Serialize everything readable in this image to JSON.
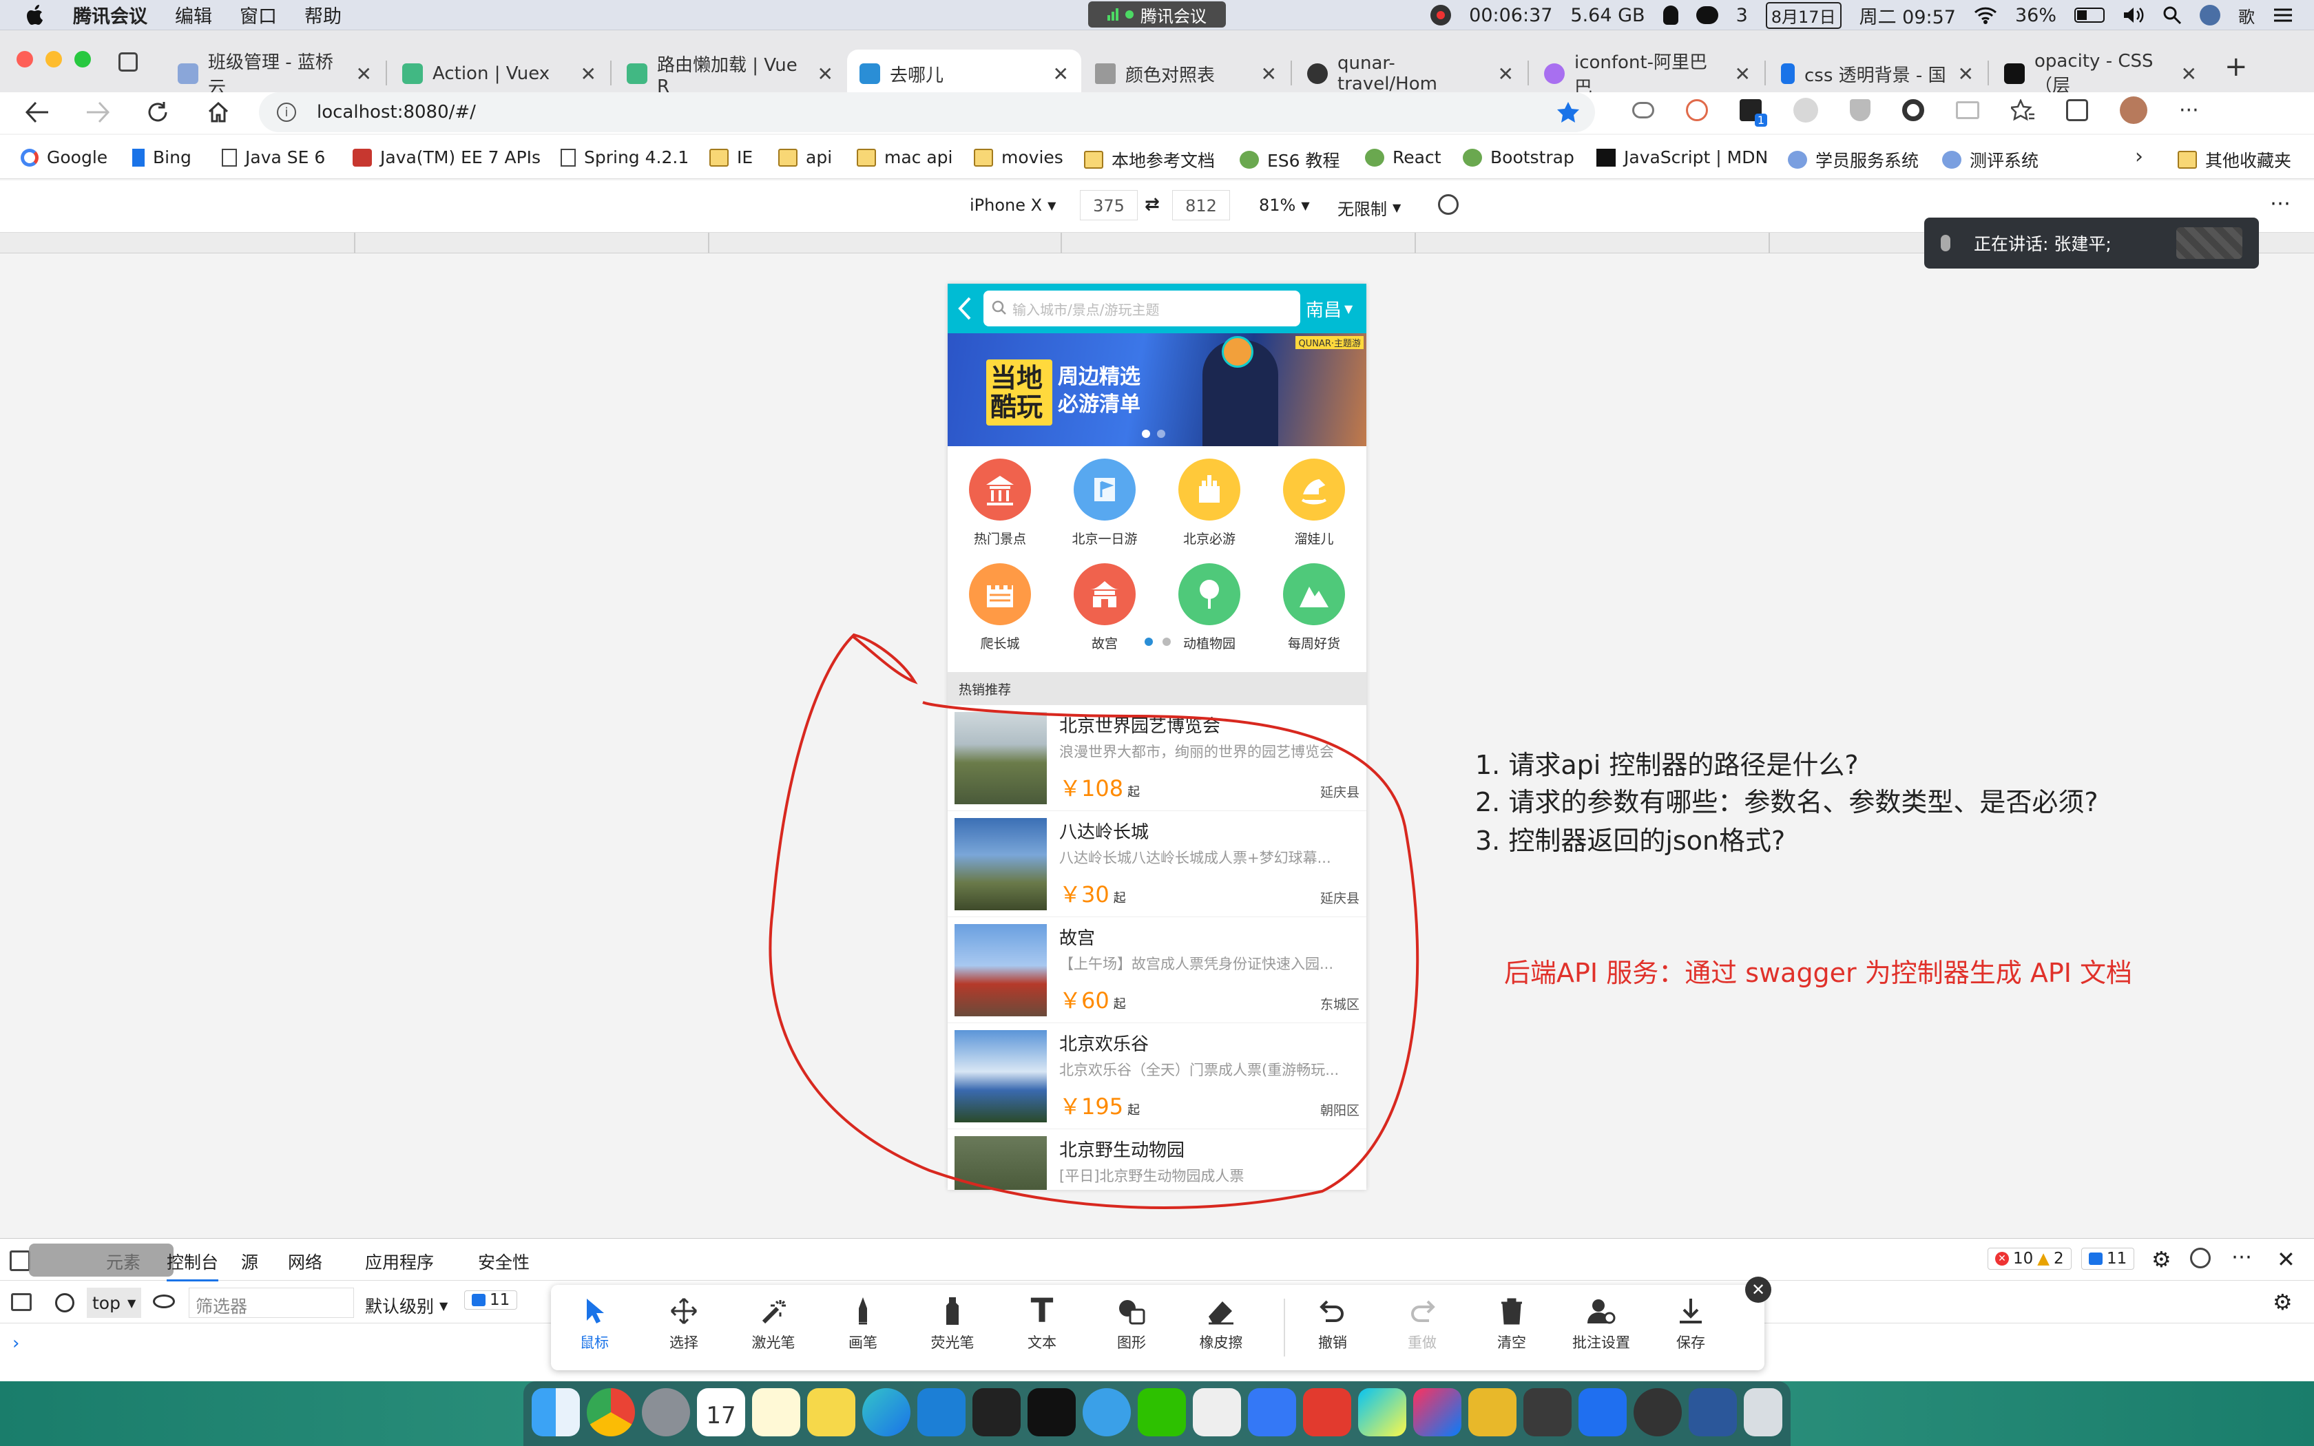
{
  "menubar": {
    "app_name": "腾讯会议",
    "menus": [
      "编辑",
      "窗口",
      "帮助"
    ],
    "meeting_pill": "腾讯会议",
    "record_time": "00:06:37",
    "memory": "5.64 GB",
    "wechat_count": "3",
    "date": "8月17日",
    "weekday_time": "周二 09:57",
    "battery": "36%"
  },
  "tabs": [
    {
      "title": "班级管理 - 蓝桥云",
      "color": "#8aa6d9"
    },
    {
      "title": "Action | Vuex",
      "color": "#41b883"
    },
    {
      "title": "路由懒加载 | Vue R",
      "color": "#41b883"
    },
    {
      "title": "去哪儿",
      "color": "#2a8ed6",
      "active": true
    },
    {
      "title": "颜色对照表",
      "color": "#999999"
    },
    {
      "title": "qunar-travel/Hom",
      "color": "#333333"
    },
    {
      "title": "iconfont-阿里巴巴",
      "color": "#a86ff0"
    },
    {
      "title": "css 透明背景 - 国",
      "color": "#1a73e8"
    },
    {
      "title": "opacity - CSS（层",
      "color": "#111111"
    }
  ],
  "address": {
    "url": "localhost:8080/#/"
  },
  "bookmarks": [
    "Google",
    "Bing",
    "Java SE 6",
    "Java(TM) EE 7 APIs",
    "Spring 4.2.1",
    "IE",
    "api",
    "mac api",
    "movies",
    "本地参考文档",
    "ES6 教程",
    "React",
    "Bootstrap",
    "JavaScript | MDN",
    "学员服务系统",
    "测评系统",
    "其他收藏夹"
  ],
  "devicebar": {
    "device": "iPhone X",
    "width": "375",
    "height": "812",
    "zoom": "81%",
    "throttle": "无限制"
  },
  "phone": {
    "search_placeholder": "输入城市/景点/游玩主题",
    "city": "南昌",
    "banner_title_1": "当地",
    "banner_title_2": "酷玩",
    "banner_sub_1": "周边精选",
    "banner_sub_2": "必游清单",
    "banner_tag": "QUNAR·主题游",
    "icons": [
      {
        "label": "热门景点",
        "color": "#f0624d"
      },
      {
        "label": "北京一日游",
        "color": "#58a8f0"
      },
      {
        "label": "北京必游",
        "color": "#ffc93a"
      },
      {
        "label": "溜娃儿",
        "color": "#ffc93a"
      },
      {
        "label": "爬长城",
        "color": "#ff9a45"
      },
      {
        "label": "故宫",
        "color": "#f0624d"
      },
      {
        "label": "动植物园",
        "color": "#4fc97a"
      },
      {
        "label": "每周好货",
        "color": "#4fc97a"
      }
    ],
    "hot_title": "热销推荐",
    "items": [
      {
        "title": "北京世界园艺博览会",
        "desc": "浪漫世界大都市，绚丽的世界的园艺博览会",
        "price": "￥108",
        "unit": "起",
        "location": "延庆县"
      },
      {
        "title": "八达岭长城",
        "desc": "八达岭长城八达岭长城成人票+梦幻球幕...",
        "price": "￥30",
        "unit": "起",
        "location": "延庆县"
      },
      {
        "title": "故宫",
        "desc": "【上午场】故宫成人票凭身份证快速入园...",
        "price": "￥60",
        "unit": "起",
        "location": "东城区"
      },
      {
        "title": "北京欢乐谷",
        "desc": "北京欢乐谷（全天）门票成人票(重游畅玩...",
        "price": "￥195",
        "unit": "起",
        "location": "朝阳区"
      },
      {
        "title": "北京野生动物园",
        "desc": "[平日]北京野生动物园成人票",
        "price": "",
        "unit": "",
        "location": ""
      }
    ]
  },
  "annotations": {
    "q1": "1. 请求api 控制器的路径是什么?",
    "q2": "2. 请求的参数有哪些：参数名、参数类型、是否必须?",
    "q3": "3. 控制器返回的json格式?",
    "red_note": "后端API 服务：通过 swagger 为控制器生成 API 文档"
  },
  "speaking": {
    "text": "正在讲话: 张建平;"
  },
  "devtools": {
    "tabs": [
      "元素",
      "控制台",
      "源",
      "网络",
      "应用程序",
      "安全性"
    ],
    "errors": "10",
    "warnings": "2",
    "messages": "11",
    "context": "top",
    "filter_placeholder": "筛选器",
    "level": "默认级别",
    "msg_count": "11"
  },
  "drawbar": {
    "tools": [
      "鼠标",
      "选择",
      "激光笔",
      "画笔",
      "荧光笔",
      "文本",
      "图形",
      "橡皮擦",
      "撤销",
      "重做",
      "清空",
      "批注设置",
      "保存"
    ]
  }
}
